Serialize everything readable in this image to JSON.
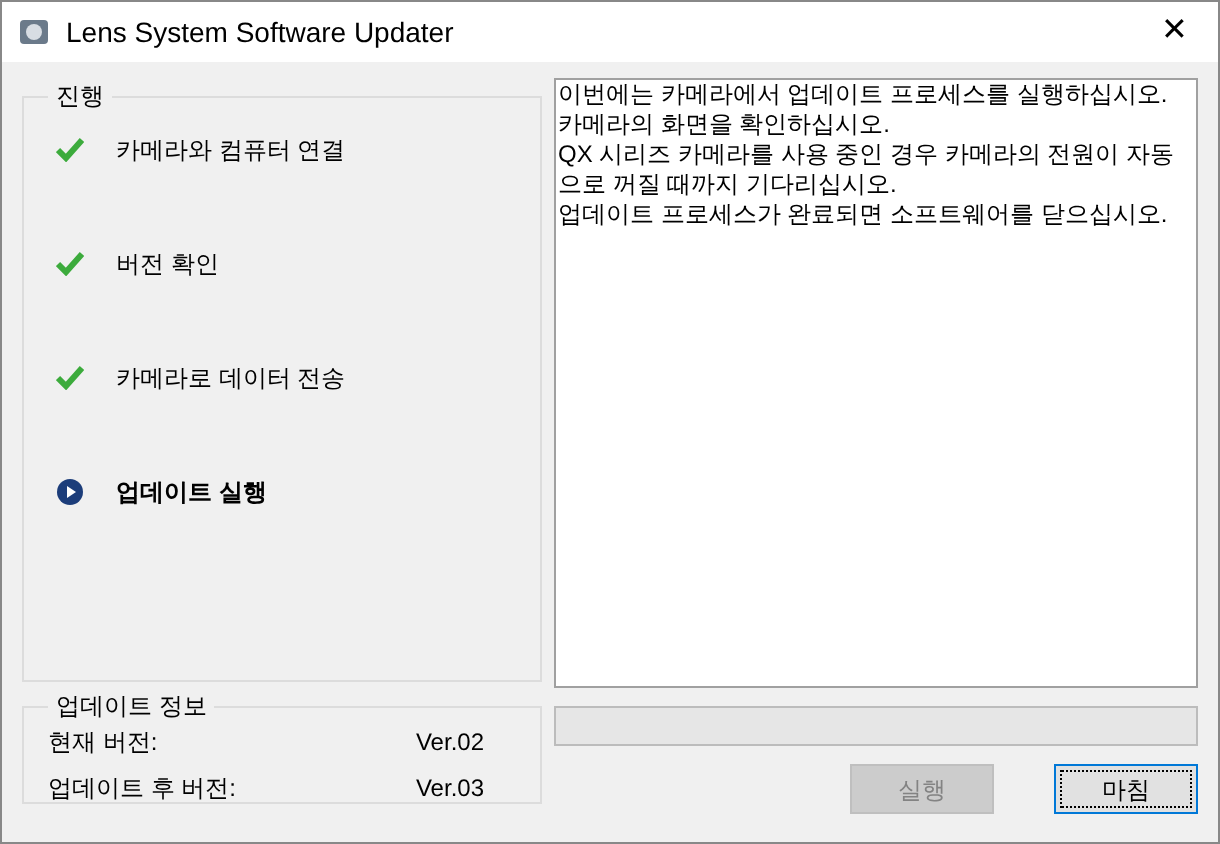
{
  "window": {
    "title": "Lens System Software Updater",
    "close": "✕"
  },
  "progress_group": {
    "title": "진행",
    "steps": [
      {
        "label": "카메라와 컴퓨터 연결",
        "kind": "done"
      },
      {
        "label": "버전 확인",
        "kind": "done"
      },
      {
        "label": "카메라로 데이터 전송",
        "kind": "done"
      },
      {
        "label": "업데이트 실행",
        "kind": "current"
      }
    ]
  },
  "message": [
    "이번에는 카메라에서 업데이트 프로세스를 실행하십시오. 카메라의 화면을 확인하십시오.",
    "QX 시리즈 카메라를 사용 중인 경우 카메라의 전원이 자동으로 꺼질 때까지 기다리십시오.",
    "업데이트 프로세스가 완료되면 소프트웨어를 닫으십시오."
  ],
  "info_group": {
    "title": "업데이트 정보",
    "rows": [
      {
        "label": "현재 버전:",
        "value": "Ver.02"
      },
      {
        "label": "업데이트 후 버전:",
        "value": "Ver.03"
      }
    ]
  },
  "progress": {
    "level": 0
  },
  "buttons": [
    {
      "label": "실행",
      "disabled": true,
      "focused": false
    },
    {
      "label": "마침",
      "disabled": false,
      "focused": true
    }
  ]
}
